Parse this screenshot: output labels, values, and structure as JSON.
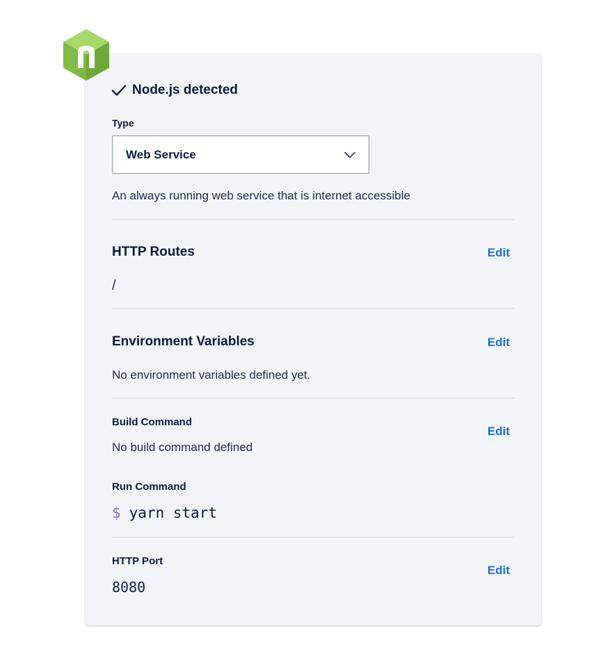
{
  "header": {
    "detected_label": "Node.js detected"
  },
  "type_section": {
    "label": "Type",
    "selected_value": "Web Service",
    "description": "An always running web service that is internet accessible"
  },
  "http_routes": {
    "title": "HTTP Routes",
    "edit_label": "Edit",
    "value": "/"
  },
  "env_vars": {
    "title": "Environment Variables",
    "edit_label": "Edit",
    "value": "No environment variables defined yet."
  },
  "commands": {
    "build_label": "Build Command",
    "build_value": "No build command defined",
    "edit_label": "Edit",
    "run_label": "Run Command",
    "run_prompt": "$",
    "run_value": "yarn start"
  },
  "http_port": {
    "label": "HTTP Port",
    "value": "8080",
    "edit_label": "Edit"
  },
  "colors": {
    "accent_link": "#1e6fd8",
    "text_primary": "#0b1a3d",
    "card_background": "#f3f4f8",
    "logo_green": "#8cc84b",
    "prompt_purple": "#8a6fd8"
  },
  "icons": {
    "logo": "nodejs-hexagon-icon",
    "detected": "check-icon",
    "select": "chevron-down-icon"
  }
}
